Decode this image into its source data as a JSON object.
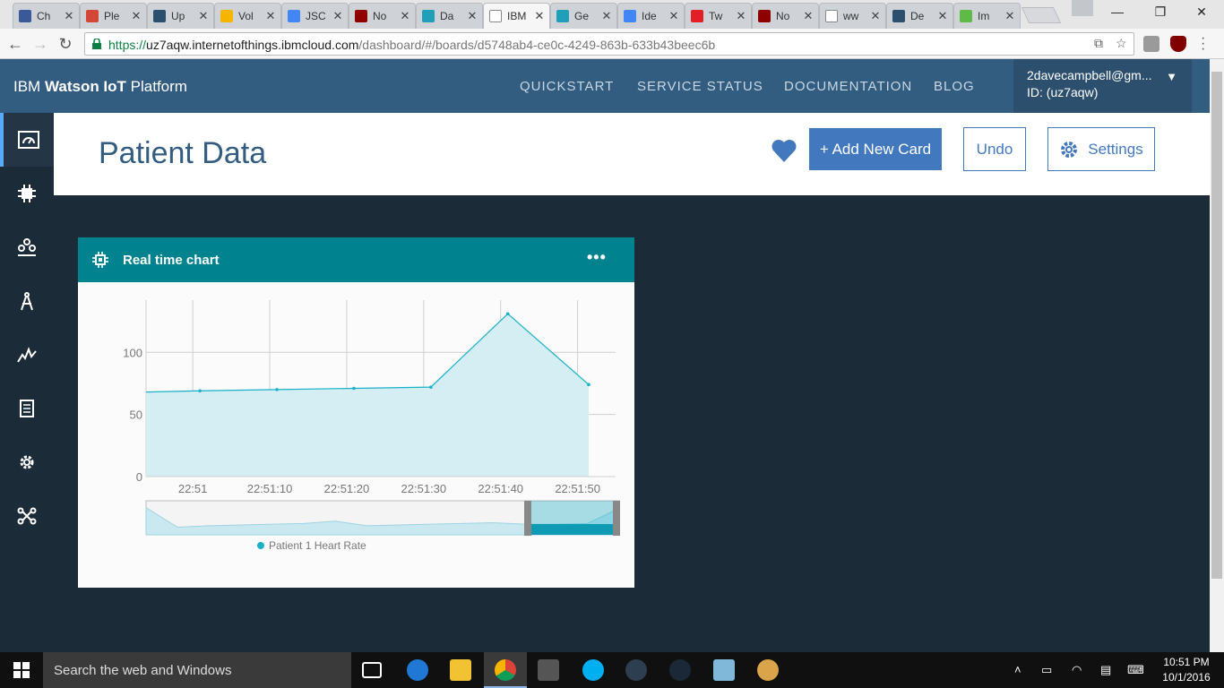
{
  "browser": {
    "tabs": [
      {
        "label": "Ch",
        "icon": "facebook-icon",
        "color": "#3b5998"
      },
      {
        "label": "Ple",
        "icon": "gmail-icon",
        "color": "#d44638"
      },
      {
        "label": "Up",
        "icon": "drupal-icon",
        "color": "#2b4f6d"
      },
      {
        "label": "Vol",
        "icon": "google-drive-icon",
        "color": "#f4b400"
      },
      {
        "label": "JSC",
        "icon": "google-docs-icon",
        "color": "#4285f4"
      },
      {
        "label": "No",
        "icon": "node-red-icon",
        "color": "#8f0000"
      },
      {
        "label": "Da",
        "icon": "watson-icon",
        "color": "#1f9fb8"
      },
      {
        "label": "IBM",
        "icon": "page-icon",
        "color": "#ffffff"
      },
      {
        "label": "Ge",
        "icon": "watson-icon",
        "color": "#1f9fb8"
      },
      {
        "label": "Ide",
        "icon": "google-docs-icon",
        "color": "#4285f4"
      },
      {
        "label": "Tw",
        "icon": "twilio-icon",
        "color": "#e31e26"
      },
      {
        "label": "No",
        "icon": "node-red-icon",
        "color": "#8f0000"
      },
      {
        "label": "ww",
        "icon": "page-icon",
        "color": "#ffffff"
      },
      {
        "label": "De",
        "icon": "drupal-icon",
        "color": "#2b4f6d"
      },
      {
        "label": "Im",
        "icon": "green-circle-icon",
        "color": "#5fbb46"
      }
    ],
    "active_tab": 7,
    "close_glyph": "✕",
    "url_scheme": "https://",
    "url_host": "uz7aqw.internetofthings.ibmcloud.com",
    "url_path": "/dashboard/#/boards/d5748ab4-ce0c-4249-863b-633b43beec6b"
  },
  "app": {
    "brand_prefix": "IBM ",
    "brand_bold": "Watson IoT",
    "brand_suffix": " Platform",
    "nav": [
      "QUICKSTART",
      "SERVICE STATUS",
      "DOCUMENTATION",
      "BLOG"
    ],
    "user_email": "2davecampbell@gm...",
    "user_id": "ID: (uz7aqw)",
    "user_caret": "▼"
  },
  "sidebar": {
    "items": [
      {
        "icon": "boards-icon",
        "active": true
      },
      {
        "icon": "devices-chip-icon",
        "active": false
      },
      {
        "icon": "members-icon",
        "active": false
      },
      {
        "icon": "rules-compass-icon",
        "active": false
      },
      {
        "icon": "usage-chart-icon",
        "active": false
      },
      {
        "icon": "apps-document-icon",
        "active": false
      },
      {
        "icon": "settings-gear-icon",
        "active": false
      },
      {
        "icon": "extensions-icon",
        "active": false
      }
    ]
  },
  "page": {
    "title": "Patient Data",
    "add_card": "+ Add New Card",
    "undo": "Undo",
    "settings": "Settings",
    "favorite_color": "#4178be"
  },
  "card": {
    "title": "Real time chart",
    "menu": "•••"
  },
  "chart_data": {
    "type": "area",
    "x": [
      "22:50:53",
      "22:51:00",
      "22:51:10",
      "22:51:20",
      "22:51:30",
      "22:51:40",
      "22:51:50"
    ],
    "x_ticks": [
      "22:51",
      "22:51:10",
      "22:51:20",
      "22:51:30",
      "22:51:40",
      "22:51:50"
    ],
    "series": [
      {
        "name": "Patient 1 Heart Rate",
        "values": [
          68,
          69,
          70,
          71,
          72,
          131,
          74
        ],
        "color": "#1ab0c8"
      }
    ],
    "yticks": [
      0,
      50,
      100
    ],
    "ylim": [
      0,
      142
    ],
    "grid": true,
    "legend": "bottom",
    "navigator": true
  },
  "taskbar": {
    "search_placeholder": "Search the web and Windows",
    "time": "10:51 PM",
    "date": "10/1/2016"
  }
}
